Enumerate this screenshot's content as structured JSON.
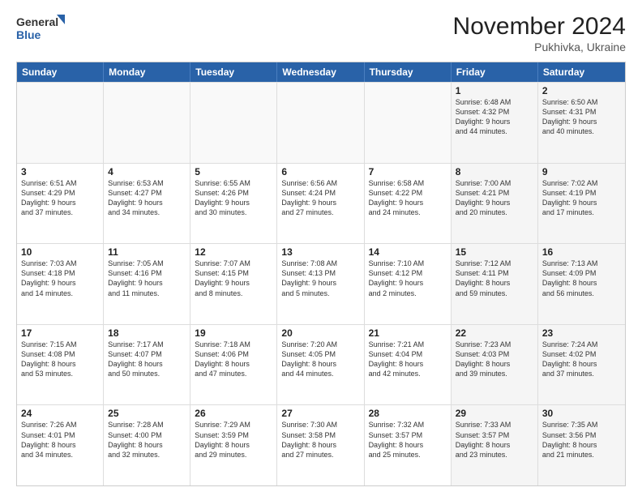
{
  "logo": {
    "general": "General",
    "blue": "Blue"
  },
  "header": {
    "month": "November 2024",
    "location": "Pukhivka, Ukraine"
  },
  "weekdays": [
    "Sunday",
    "Monday",
    "Tuesday",
    "Wednesday",
    "Thursday",
    "Friday",
    "Saturday"
  ],
  "rows": [
    [
      {
        "day": "",
        "info": ""
      },
      {
        "day": "",
        "info": ""
      },
      {
        "day": "",
        "info": ""
      },
      {
        "day": "",
        "info": ""
      },
      {
        "day": "",
        "info": ""
      },
      {
        "day": "1",
        "info": "Sunrise: 6:48 AM\nSunset: 4:32 PM\nDaylight: 9 hours\nand 44 minutes."
      },
      {
        "day": "2",
        "info": "Sunrise: 6:50 AM\nSunset: 4:31 PM\nDaylight: 9 hours\nand 40 minutes."
      }
    ],
    [
      {
        "day": "3",
        "info": "Sunrise: 6:51 AM\nSunset: 4:29 PM\nDaylight: 9 hours\nand 37 minutes."
      },
      {
        "day": "4",
        "info": "Sunrise: 6:53 AM\nSunset: 4:27 PM\nDaylight: 9 hours\nand 34 minutes."
      },
      {
        "day": "5",
        "info": "Sunrise: 6:55 AM\nSunset: 4:26 PM\nDaylight: 9 hours\nand 30 minutes."
      },
      {
        "day": "6",
        "info": "Sunrise: 6:56 AM\nSunset: 4:24 PM\nDaylight: 9 hours\nand 27 minutes."
      },
      {
        "day": "7",
        "info": "Sunrise: 6:58 AM\nSunset: 4:22 PM\nDaylight: 9 hours\nand 24 minutes."
      },
      {
        "day": "8",
        "info": "Sunrise: 7:00 AM\nSunset: 4:21 PM\nDaylight: 9 hours\nand 20 minutes."
      },
      {
        "day": "9",
        "info": "Sunrise: 7:02 AM\nSunset: 4:19 PM\nDaylight: 9 hours\nand 17 minutes."
      }
    ],
    [
      {
        "day": "10",
        "info": "Sunrise: 7:03 AM\nSunset: 4:18 PM\nDaylight: 9 hours\nand 14 minutes."
      },
      {
        "day": "11",
        "info": "Sunrise: 7:05 AM\nSunset: 4:16 PM\nDaylight: 9 hours\nand 11 minutes."
      },
      {
        "day": "12",
        "info": "Sunrise: 7:07 AM\nSunset: 4:15 PM\nDaylight: 9 hours\nand 8 minutes."
      },
      {
        "day": "13",
        "info": "Sunrise: 7:08 AM\nSunset: 4:13 PM\nDaylight: 9 hours\nand 5 minutes."
      },
      {
        "day": "14",
        "info": "Sunrise: 7:10 AM\nSunset: 4:12 PM\nDaylight: 9 hours\nand 2 minutes."
      },
      {
        "day": "15",
        "info": "Sunrise: 7:12 AM\nSunset: 4:11 PM\nDaylight: 8 hours\nand 59 minutes."
      },
      {
        "day": "16",
        "info": "Sunrise: 7:13 AM\nSunset: 4:09 PM\nDaylight: 8 hours\nand 56 minutes."
      }
    ],
    [
      {
        "day": "17",
        "info": "Sunrise: 7:15 AM\nSunset: 4:08 PM\nDaylight: 8 hours\nand 53 minutes."
      },
      {
        "day": "18",
        "info": "Sunrise: 7:17 AM\nSunset: 4:07 PM\nDaylight: 8 hours\nand 50 minutes."
      },
      {
        "day": "19",
        "info": "Sunrise: 7:18 AM\nSunset: 4:06 PM\nDaylight: 8 hours\nand 47 minutes."
      },
      {
        "day": "20",
        "info": "Sunrise: 7:20 AM\nSunset: 4:05 PM\nDaylight: 8 hours\nand 44 minutes."
      },
      {
        "day": "21",
        "info": "Sunrise: 7:21 AM\nSunset: 4:04 PM\nDaylight: 8 hours\nand 42 minutes."
      },
      {
        "day": "22",
        "info": "Sunrise: 7:23 AM\nSunset: 4:03 PM\nDaylight: 8 hours\nand 39 minutes."
      },
      {
        "day": "23",
        "info": "Sunrise: 7:24 AM\nSunset: 4:02 PM\nDaylight: 8 hours\nand 37 minutes."
      }
    ],
    [
      {
        "day": "24",
        "info": "Sunrise: 7:26 AM\nSunset: 4:01 PM\nDaylight: 8 hours\nand 34 minutes."
      },
      {
        "day": "25",
        "info": "Sunrise: 7:28 AM\nSunset: 4:00 PM\nDaylight: 8 hours\nand 32 minutes."
      },
      {
        "day": "26",
        "info": "Sunrise: 7:29 AM\nSunset: 3:59 PM\nDaylight: 8 hours\nand 29 minutes."
      },
      {
        "day": "27",
        "info": "Sunrise: 7:30 AM\nSunset: 3:58 PM\nDaylight: 8 hours\nand 27 minutes."
      },
      {
        "day": "28",
        "info": "Sunrise: 7:32 AM\nSunset: 3:57 PM\nDaylight: 8 hours\nand 25 minutes."
      },
      {
        "day": "29",
        "info": "Sunrise: 7:33 AM\nSunset: 3:57 PM\nDaylight: 8 hours\nand 23 minutes."
      },
      {
        "day": "30",
        "info": "Sunrise: 7:35 AM\nSunset: 3:56 PM\nDaylight: 8 hours\nand 21 minutes."
      }
    ]
  ]
}
